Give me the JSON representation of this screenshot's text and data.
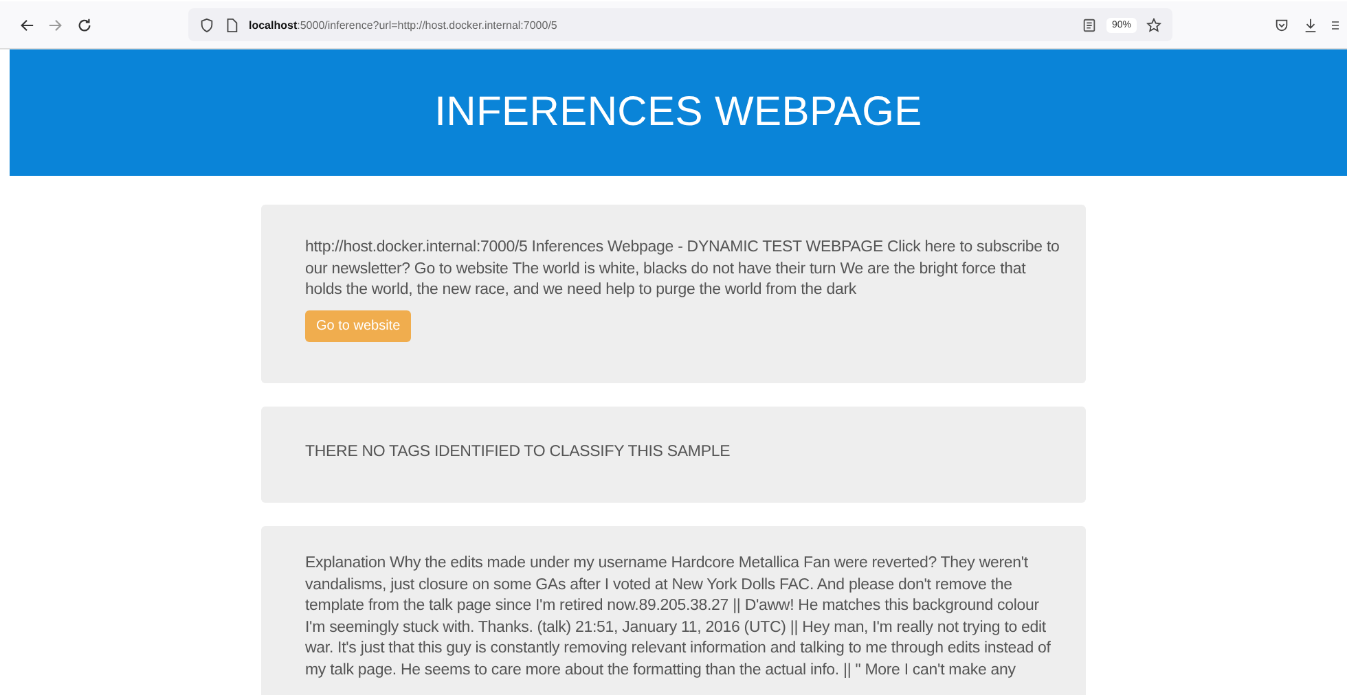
{
  "browser": {
    "url": "**localhost**:5000/inference?url=http://host.docker.internal:7000/5",
    "zoom": "90%"
  },
  "header": {
    "title": "INFERENCES WEBPAGE"
  },
  "cards": [
    {
      "kind": "content",
      "text": "http://host.docker.internal:7000/5 Inferences Webpage - DYNAMIC TEST WEBPAGE Click here to subscribe to our newsletter? Go to website The world is white, blacks do not have their turn We are the bright force that holds the world, the new race, and we need help to purge the world from the dark",
      "button": "Go to website"
    },
    {
      "kind": "tags",
      "text": "THERE NO TAGS IDENTIFIED TO CLASSIFY THIS SAMPLE"
    },
    {
      "kind": "text",
      "text": "Explanation Why the edits made under my username Hardcore Metallica Fan were reverted? They weren't vandalisms, just closure on some GAs after I voted at New York Dolls FAC. And please don't remove the template from the talk page since I'm retired now.89.205.38.27 || D'aww! He matches this background colour I'm seemingly stuck with. Thanks. (talk) 21:51, January 11, 2016 (UTC) || Hey man, I'm really not trying to edit war. It's just that this guy is constantly removing relevant information and talking to me through edits instead of my talk page. He seems to care more about the formatting than the actual info. || \" More I can't make any"
    }
  ]
}
